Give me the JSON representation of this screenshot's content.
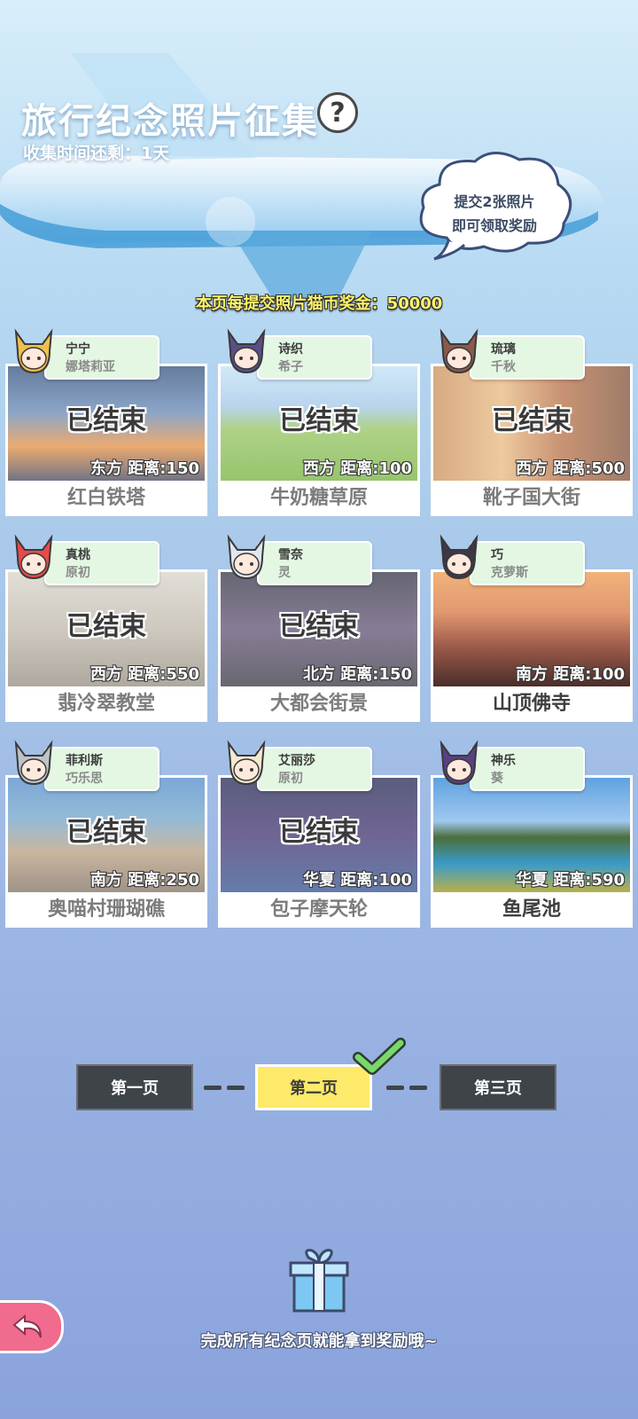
{
  "header": {
    "title": "旅行纪念照片征集",
    "help_symbol": "?",
    "time_left": "收集时间还剩：1天",
    "cloud_lines": [
      "提交2张照片",
      "即可领取奖励"
    ],
    "reward_line": "本页每提交照片猫币奖金：50000"
  },
  "cards": [
    {
      "char": "宁宁",
      "char2": "娜塔莉亚",
      "status": "已结束",
      "dist": "东方  距离:150",
      "name": "红白铁塔",
      "done": true,
      "avatar_color": "#f2c04a"
    },
    {
      "char": "诗织",
      "char2": "希子",
      "status": "已结束",
      "dist": "西方  距离:100",
      "name": "牛奶糖草原",
      "done": true,
      "avatar_color": "#5a4f86"
    },
    {
      "char": "琉璃",
      "char2": "千秋",
      "status": "已结束",
      "dist": "西方  距离:500",
      "name": "靴子国大街",
      "done": true,
      "avatar_color": "#8a5a4a"
    },
    {
      "char": "真桃",
      "char2": "原初",
      "status": "已结束",
      "dist": "西方  距离:550",
      "name": "翡冷翠教堂",
      "done": true,
      "avatar_color": "#e84a4a"
    },
    {
      "char": "雪奈",
      "char2": "灵",
      "status": "已结束",
      "dist": "北方  距离:150",
      "name": "大都会街景",
      "done": true,
      "avatar_color": "#dfe6ef"
    },
    {
      "char": "巧",
      "char2": "克萝斯",
      "status": "",
      "dist": "南方  距离:100",
      "name": "山顶佛寺",
      "done": false,
      "avatar_color": "#3f3646"
    },
    {
      "char": "菲利斯",
      "char2": "巧乐思",
      "status": "已结束",
      "dist": "南方  距离:250",
      "name": "奥喵村珊瑚礁",
      "done": true,
      "avatar_color": "#bfc3c8"
    },
    {
      "char": "艾丽莎",
      "char2": "原初",
      "status": "已结束",
      "dist": "华夏  距离:100",
      "name": "包子摩天轮",
      "done": true,
      "avatar_color": "#f4ead0"
    },
    {
      "char": "神乐",
      "char2": "葵",
      "status": "",
      "dist": "华夏  距离:590",
      "name": "鱼尾池",
      "done": false,
      "avatar_color": "#5b3f86"
    }
  ],
  "pager": {
    "pages": [
      "第一页",
      "第二页",
      "第三页"
    ],
    "current": 1
  },
  "footer": {
    "text": "完成所有纪念页就能拿到奖励哦~"
  },
  "colors": {
    "accent_yellow": "#fde96a",
    "dark_button": "#3f4449",
    "tag_green": "#e3f7e3",
    "back_pink": "#f06b8d"
  }
}
